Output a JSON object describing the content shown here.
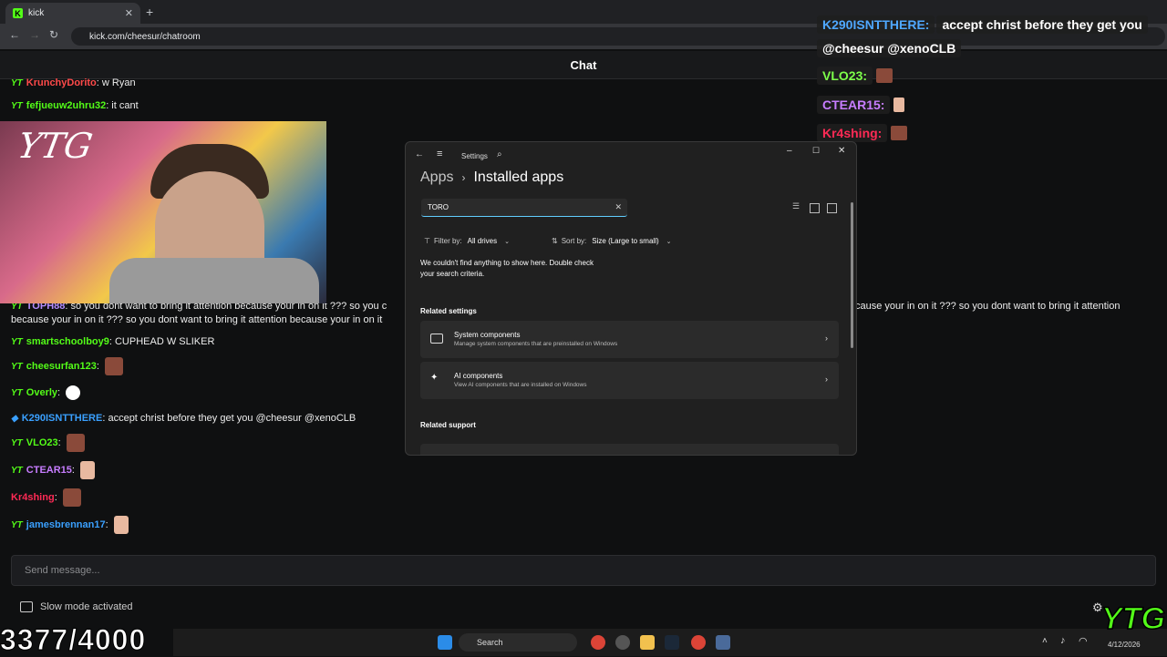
{
  "browser": {
    "tab_title": "kick",
    "tab_close": "✕",
    "new_tab": "+",
    "url": "kick.com/cheesur/chatroom"
  },
  "chat": {
    "header": "Chat",
    "messages": [
      {
        "user": "KrunchyDorito",
        "text": ": w Ryan",
        "color": "#ff4a4a"
      },
      {
        "user": "fefjueuw2uhru32",
        "text": ": it cant",
        "color": "#53fc18"
      },
      {
        "user": "TOPH88",
        "text": ": so you dont want to bring it attention because your in on it ??? so you c",
        "color": "#b48cff"
      },
      {
        "line2": "because your in on it ??? so you dont want to bring it attention because your in on it"
      },
      {
        "user": "smartschoolboy9",
        "text": ": CUPHEAD W SLIKER",
        "color": "#53fc18"
      },
      {
        "user": "cheesurfan123",
        "text": ":",
        "color": "#53fc18"
      },
      {
        "user": "Overly",
        "text": ":",
        "color": "#53fc18"
      },
      {
        "user": "K290ISNTTHERE",
        "text": ": accept christ before they get you @cheesur @xenoCLB",
        "color": "#3aa0ff"
      },
      {
        "user": "VLO23",
        "text": ":",
        "color": "#53fc18"
      },
      {
        "user": "CTEAR15",
        "text": ":",
        "color": "#c77dff"
      },
      {
        "user": "Kr4shing",
        "text": ":",
        "color": "#ff2a55"
      },
      {
        "user": "jamesbrennan17",
        "text": ":",
        "color": "#3aa0ff"
      }
    ],
    "overflow_right": "cause your in on it ??? so you dont want to bring it attention",
    "send_placeholder": "Send message...",
    "slow_mode": "Slow mode activated"
  },
  "stream": {
    "cam_logo": "YTG",
    "counter": "3377/4000",
    "overlay": [
      {
        "user": "K290ISNTTHERE:",
        "text": "accept christ before they get you",
        "color": "#4fa8ff"
      },
      {
        "text2": "@cheesur @xenoCLB"
      },
      {
        "user": "VLO23:",
        "color": "#7dff4a"
      },
      {
        "user": "CTEAR15:",
        "color": "#c77dff"
      },
      {
        "user": "Kr4shing:",
        "color": "#ff2a55"
      }
    ],
    "brand_logo": "YTG"
  },
  "settings": {
    "window_title": "Settings",
    "breadcrumb_parent": "Apps",
    "breadcrumb_sep": "›",
    "breadcrumb_current": "Installed apps",
    "search_value": "TORO",
    "filter_label": "Filter by:",
    "filter_value": "All drives",
    "sort_label": "Sort by:",
    "sort_value": "Size (Large to small)",
    "empty_message": "We couldn't find anything to show here. Double check your search criteria.",
    "related_settings": "Related settings",
    "cards": [
      {
        "title": "System components",
        "subtitle": "Manage system components that are preinstalled on Windows"
      },
      {
        "title": "AI components",
        "subtitle": "View AI components that are installed on Windows"
      }
    ],
    "related_support": "Related support"
  },
  "taskbar": {
    "search_label": "Search",
    "date": "4/12/2026"
  }
}
